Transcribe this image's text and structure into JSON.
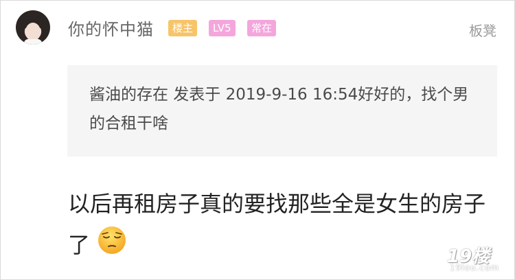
{
  "post": {
    "username": "你的怀中猫",
    "badges": [
      "楼主",
      "LV5",
      "常在"
    ],
    "floor_label": "板凳",
    "quote_text": "酱油的存在 发表于 2019-9-16 16:54好好的，找个男的合租干啥",
    "body_text": "以后再租房子真的要找那些全是女生的房子了",
    "emoji_icon": "pensive-face-emoji"
  },
  "watermark": {
    "main": "19楼",
    "sub": "19lou.com"
  },
  "colors": {
    "badge_owner": "#f7c46a",
    "badge_pink": "#f4a6dc",
    "quote_bg": "#f5f5f5",
    "username": "#666666",
    "floor": "#9a9a9a"
  }
}
